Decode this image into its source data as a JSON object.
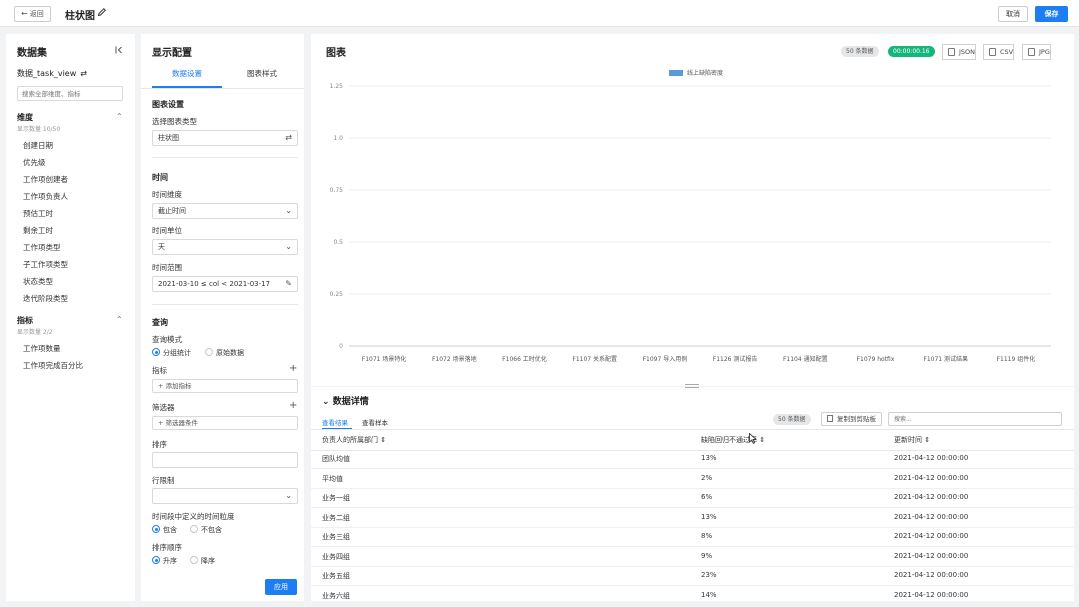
{
  "header": {
    "back_label": "返回",
    "title": "柱状图",
    "cancel_label": "取消",
    "save_label": "保存"
  },
  "dataset": {
    "title": "数据集",
    "name": "数据_task_view",
    "search_placeholder": "搜索全部维度、指标",
    "dimensions": {
      "title": "维度",
      "subtitle": "显示数量 10/50",
      "items": [
        "创建日期",
        "优先级",
        "工作项创建者",
        "工作项负责人",
        "预估工时",
        "剩余工时",
        "工作项类型",
        "子工作项类型",
        "状态类型",
        "迭代阶段类型"
      ]
    },
    "metrics": {
      "title": "指标",
      "subtitle": "显示数量 2/2",
      "items": [
        "工作项数量",
        "工作项完成百分比"
      ]
    }
  },
  "config": {
    "title": "显示配置",
    "tabs": [
      "数据设置",
      "图表样式"
    ],
    "chart_settings": {
      "heading": "图表设置",
      "type_label": "选择图表类型",
      "type_value": "柱状图"
    },
    "time": {
      "heading": "时间",
      "dimension_label": "时间维度",
      "dimension_value": "截止时间",
      "unit_label": "时间单位",
      "unit_value": "天",
      "range_label": "时间范围",
      "range_value": "2021-03-10 ≤ col < 2021-03-17"
    },
    "query": {
      "heading": "查询",
      "mode_label": "查询模式",
      "mode_options": [
        "分组统计",
        "原始数据"
      ],
      "metrics_label": "指标",
      "add_metric": "添加指标",
      "filter_label": "筛选器",
      "add_filter": "筛选器条件",
      "sort_label": "排序",
      "limit_label": "行限制",
      "granularity_label": "时间段中定义的时间粒度",
      "granularity_options": [
        "包含",
        "不包含"
      ],
      "order_label": "排序顺序",
      "order_options": [
        "升序",
        "降序"
      ]
    },
    "apply_label": "应用"
  },
  "chart": {
    "title": "图表",
    "count_badge": "50 条数据",
    "time_badge": "00:00:00.16",
    "exports": [
      "JSON",
      "CSV",
      "JPG"
    ],
    "accent": "#13b77b",
    "brand": "#1d7df2"
  },
  "chart_data": {
    "type": "bar",
    "categories": [
      "F1071 场景特化",
      "F1072 场景落地",
      "F1066 工时优化",
      "F1107 关系配置",
      "F1097 导入用例",
      "F1126 测试报告",
      "F1104 通知配置",
      "F1079 hotfix",
      "F1071 测试结果",
      "F1119 组件化"
    ],
    "series": [
      {
        "name": "线上缺陷密度",
        "values": [
          0,
          0,
          0,
          0,
          0,
          0,
          0,
          0,
          0,
          0
        ],
        "color": "#5b9bd5"
      }
    ],
    "yticks": [
      "0",
      "0.25",
      "0.5",
      "0.75",
      "1.0",
      "1.25"
    ],
    "ylim": [
      0,
      1.25
    ],
    "grid": true,
    "legend": "top-center"
  },
  "details": {
    "title": "数据详情",
    "tabs": [
      "查看结果",
      "查看样本"
    ],
    "count_badge": "50 条数据",
    "copy_label": "复制到剪贴板",
    "search_placeholder": "搜索...",
    "columns": [
      "负责人的所属部门",
      "缺陷回归不通过率",
      "更新时间"
    ],
    "rows": [
      [
        "团队均值",
        "13%",
        "2021-04-12 00:00:00"
      ],
      [
        "平均值",
        "2%",
        "2021-04-12 00:00:00"
      ],
      [
        "业务一组",
        "6%",
        "2021-04-12 00:00:00"
      ],
      [
        "业务二组",
        "13%",
        "2021-04-12 00:00:00"
      ],
      [
        "业务三组",
        "8%",
        "2021-04-12 00:00:00"
      ],
      [
        "业务四组",
        "9%",
        "2021-04-12 00:00:00"
      ],
      [
        "业务五组",
        "23%",
        "2021-04-12 00:00:00"
      ],
      [
        "业务六组",
        "14%",
        "2021-04-12 00:00:00"
      ]
    ]
  }
}
